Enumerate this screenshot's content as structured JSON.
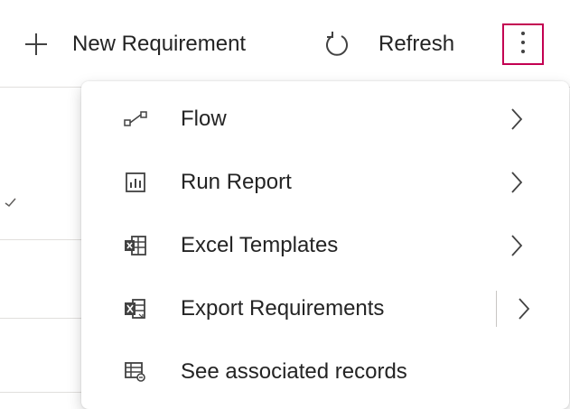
{
  "commandbar": {
    "new_label": "New Requirement",
    "refresh_label": "Refresh"
  },
  "menu": {
    "items": [
      {
        "label": "Flow",
        "icon": "flow-icon",
        "has_submenu": true
      },
      {
        "label": "Run Report",
        "icon": "report-icon",
        "has_submenu": true
      },
      {
        "label": "Excel Templates",
        "icon": "excel-template-icon",
        "has_submenu": true
      },
      {
        "label": "Export Requirements",
        "icon": "excel-export-icon",
        "has_submenu": true,
        "split": true
      },
      {
        "label": "See associated records",
        "icon": "associated-records-icon",
        "has_submenu": false
      }
    ]
  },
  "colors": {
    "accent_border": "#c30052",
    "text": "#242424",
    "divider": "#e1dfdd"
  }
}
